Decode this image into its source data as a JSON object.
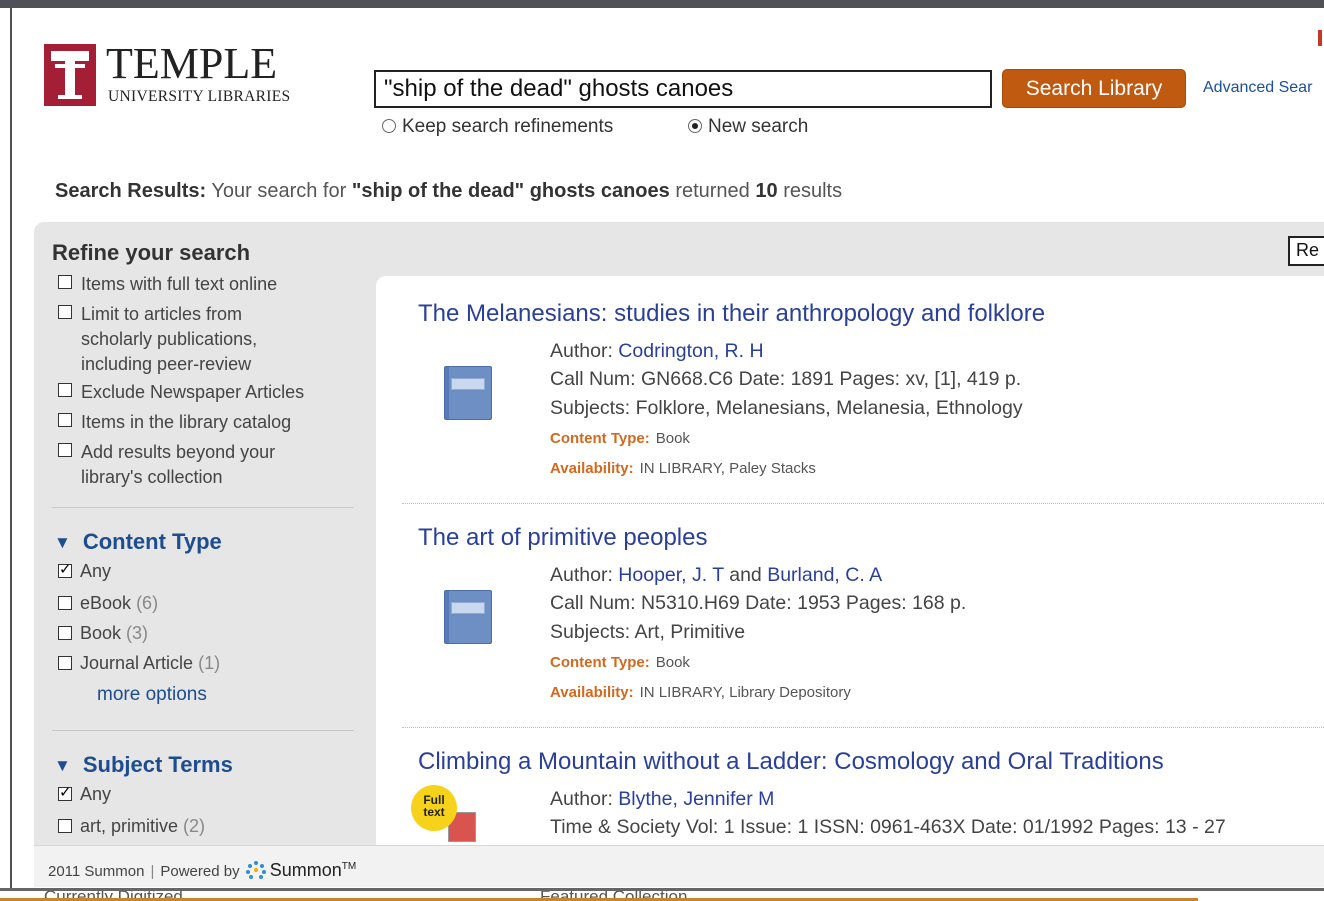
{
  "header": {
    "logo_word": "TEMPLE",
    "logo_sub": "UNIVERSITY LIBRARIES",
    "search_value": "\"ship of the dead\" ghosts canoes",
    "search_button": "Search Library",
    "advanced_link": "Advanced Sear",
    "radio_keep": "Keep search refinements",
    "radio_new": "New search",
    "radio_selected": "New search"
  },
  "results_summary": {
    "label": "Search Results:",
    "prefix": "Your search for",
    "query": "\"ship of the dead\" ghosts canoes",
    "mid": "returned",
    "count": "10",
    "suffix": "results"
  },
  "sort_box": "Re",
  "refine": {
    "title": "Refine your search",
    "options": [
      {
        "label": "Items with full text online",
        "checked": false
      },
      {
        "label": "Limit to articles from scholarly publications, including peer-review",
        "checked": false
      },
      {
        "label": "Exclude Newspaper Articles",
        "checked": false
      },
      {
        "label": "Items in the library catalog",
        "checked": false
      },
      {
        "label": "Add results beyond your library's collection",
        "checked": false
      }
    ]
  },
  "facets": {
    "content_type": {
      "title": "Content Type",
      "items": [
        {
          "label": "Any",
          "count": "",
          "checked": true
        },
        {
          "label": "eBook",
          "count": "(6)",
          "checked": false
        },
        {
          "label": "Book",
          "count": "(3)",
          "checked": false
        },
        {
          "label": "Journal Article",
          "count": "(1)",
          "checked": false
        }
      ],
      "more": "more options"
    },
    "subject_terms": {
      "title": "Subject Terms",
      "items": [
        {
          "label": "Any",
          "count": "",
          "checked": true
        },
        {
          "label": "art, primitive",
          "count": "(2)",
          "checked": false
        }
      ]
    }
  },
  "results": [
    {
      "title": "The Melanesians: studies in their anthropology and folklore",
      "author_label": "Author:",
      "authors": [
        "Codrington, R. H"
      ],
      "author_join": "",
      "callnum_line": "Call Num: GN668.C6 Date: 1891 Pages: xv, [1], 419 p.",
      "subjects_line": "Subjects: Folklore, Melanesians, Melanesia, Ethnology",
      "content_type_label": "Content Type:",
      "content_type": "Book",
      "availability_label": "Availability:",
      "availability": "IN LIBRARY,  Paley Stacks"
    },
    {
      "title": "The art of primitive peoples",
      "author_label": "Author:",
      "authors": [
        "Hooper, J. T",
        "Burland, C. A"
      ],
      "author_join": "and",
      "callnum_line": "Call Num: N5310.H69 Date: 1953 Pages: 168 p.",
      "subjects_line": "Subjects: Art, Primitive",
      "content_type_label": "Content Type:",
      "content_type": "Book",
      "availability_label": "Availability:",
      "availability": "IN LIBRARY,  Library Depository"
    },
    {
      "title": "Climbing a Mountain without a Ladder: Cosmology and Oral Traditions",
      "author_label": "Author:",
      "authors": [
        "Blythe, Jennifer M"
      ],
      "badge": "Full text",
      "details_line": "Time & Society Vol: 1 Issue: 1 ISSN: 0961-463X Date: 01/1992 Pages: 13 - 27"
    }
  ],
  "footer": {
    "year_text": "2011 Summon",
    "powered_by": "Powered by",
    "brand": "Summon",
    "tm": "TM"
  },
  "behind_page": {
    "left_text": "Currently Digitized",
    "right_text": "Featured Collection"
  },
  "colors": {
    "brand_red": "#a41e35",
    "search_button": "#c05a10",
    "link_blue": "#2a3f9a",
    "facet_blue": "#1d4d8f",
    "meta_orange": "#d2691e"
  }
}
